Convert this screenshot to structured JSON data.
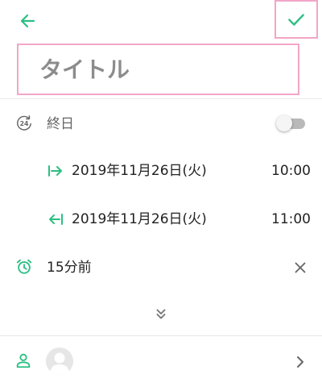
{
  "header": {
    "back_icon": "arrow-left-icon",
    "confirm_icon": "check-icon",
    "accent_color": "#2bbf83",
    "highlight_color": "#f2a6c8"
  },
  "title": {
    "placeholder": "タイトル",
    "value": ""
  },
  "all_day": {
    "label": "終日",
    "icon": "24h-icon",
    "enabled": false
  },
  "start": {
    "date": "2019年11月26日(火)",
    "time": "10:00",
    "icon": "arrow-in-icon"
  },
  "end": {
    "date": "2019年11月26日(火)",
    "time": "11:00",
    "icon": "arrow-out-icon"
  },
  "reminder": {
    "label": "15分前",
    "icon": "alarm-icon",
    "remove_icon": "close-icon"
  },
  "expand": {
    "icon": "double-chevron-down-icon"
  },
  "attendee": {
    "icon": "person-icon",
    "chevron_icon": "chevron-right-icon"
  }
}
